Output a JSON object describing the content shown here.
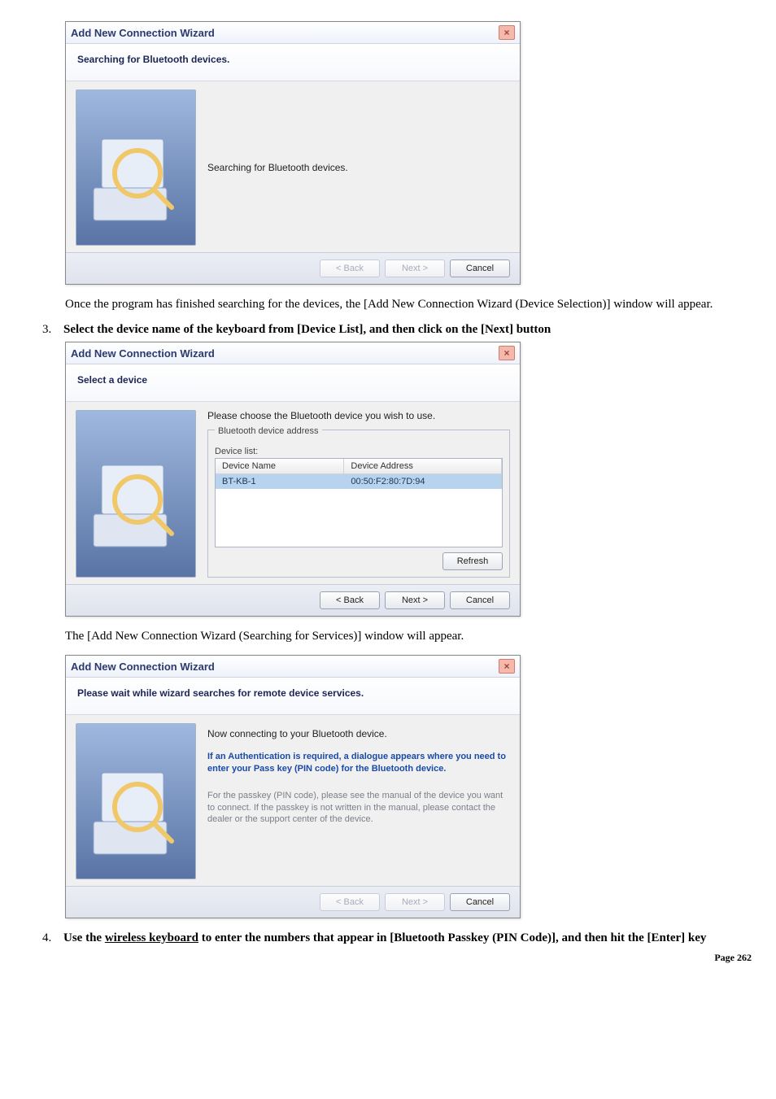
{
  "dialog1": {
    "title": "Add New Connection Wizard",
    "header": "Searching for Bluetooth devices.",
    "body_text": "Searching for Bluetooth devices.",
    "buttons": {
      "back": "< Back",
      "next": "Next >",
      "cancel": "Cancel"
    }
  },
  "para1": "Once the program has finished searching for the devices, the [Add New Connection Wizard (Device Selection)] window will appear.",
  "step3": {
    "num": "3.",
    "text": "Select the device name of the keyboard from [Device List], and then click on the [Next] button"
  },
  "dialog2": {
    "title": "Add New Connection Wizard",
    "header": "Select a device",
    "body_text": "Please choose the Bluetooth device you wish to use.",
    "fieldset_legend": "Bluetooth device address",
    "sublabel": "Device list:",
    "col1": "Device Name",
    "col2": "Device Address",
    "row_name": "BT-KB-1",
    "row_addr": "00:50:F2:80:7D:94",
    "refresh": "Refresh",
    "buttons": {
      "back": "< Back",
      "next": "Next >",
      "cancel": "Cancel"
    }
  },
  "para2": "The [Add New Connection Wizard (Searching for Services)] window will appear.",
  "dialog3": {
    "title": "Add New Connection Wizard",
    "header": "Please wait while wizard searches for remote device services.",
    "line1": "Now connecting to your Bluetooth device.",
    "blue_block": "If an Authentication is required, a dialogue appears where you need to enter your Pass key (PIN code) for the Bluetooth device.",
    "gray_block": "For the passkey (PIN code), please see the manual of the device you want to connect. If the passkey is not written in the manual, please contact the dealer or the support center of the device.",
    "buttons": {
      "back": "< Back",
      "next": "Next >",
      "cancel": "Cancel"
    }
  },
  "step4": {
    "num": "4.",
    "text_prefix": "Use the ",
    "text_underlined": "wireless keyboard",
    "text_suffix": " to enter the numbers that appear in [Bluetooth Passkey (PIN Code)], and then hit the [Enter] key"
  },
  "footer": "Page 262"
}
